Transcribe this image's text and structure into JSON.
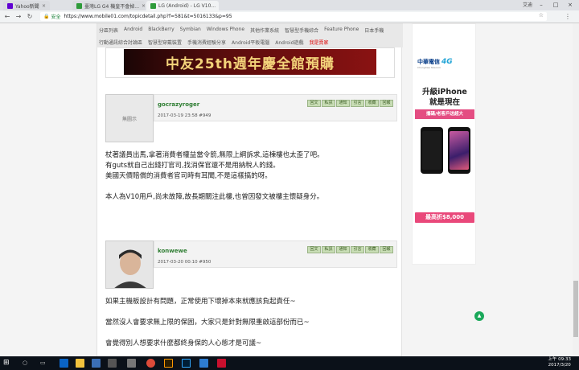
{
  "browser": {
    "tabs": [
      {
        "label": "Yahoo新聞"
      },
      {
        "label": "臺灣LG G4 機皇不會掉..."
      },
      {
        "label": "LG (Android) - LG V10..."
      }
    ],
    "profile_name": "艾迪",
    "secure_label": "安全",
    "url": "https://www.mobile01.com/topicdetail.php?f=581&t=5016133&p=95"
  },
  "site": {
    "category_row1": [
      "分區列表",
      "Android",
      "BlackBerry",
      "Symbian",
      "Windows Phone",
      "其他作業系統",
      "智慧型手機綜合",
      "Feature Phone",
      "日本手機"
    ],
    "category_row2": [
      "行動通訊綜合討論區",
      "智慧型穿戴裝置",
      "手機消費經驗分享",
      "Android平板電腦",
      "Android遊戲"
    ],
    "category_highlight": "我是賣家",
    "banner_text": "中友25th週年慶全館預購"
  },
  "post_buttons": [
    "回文",
    "私訊",
    "通知",
    "引言",
    "收藏",
    "回報"
  ],
  "posts": [
    {
      "username": "gocrazyroger",
      "avatar_text": "無圖示",
      "meta": "2017-03-19 23:58  #949",
      "lines": [
        "杖著議員出馬,拿著消費者權益當令箭,無限上綱訴求,這棟樓也太歪了吧。",
        "有guts就自己出錢打官司,找消保官還不是用納稅人的錢。",
        "美國天價賠償的消費者官司時有耳聞,不是這樣搞的呀。",
        "",
        "本人為V10用戶,尚未故障,故長期關注此樓,也曾因發文被樓主懷疑身分。"
      ]
    },
    {
      "username": "konwewe",
      "meta": "2017-03-20 00:10  #950",
      "lines": [
        "如果主機板設計有問題，正常使用下壞掉本來就應該負起責任~",
        "",
        "當然沒人會要求無上限的保固，大家只是針對無限重啟這部份而已~",
        "",
        "會覺得別人想要求什麼都終身保的人心態才是可議~"
      ]
    }
  ],
  "sidebar": {
    "brand": "中華電信",
    "brand_tag": "4G",
    "brand_sub": "Chunghwa Telecom",
    "headline1": "升級iPhone",
    "headline2": "就是現在",
    "pink_label": "攜碼/老客戶送超大",
    "cta": "最高折$8,000"
  },
  "taskbar": {
    "time": "上午 09:33",
    "date": "2017/3/20"
  }
}
